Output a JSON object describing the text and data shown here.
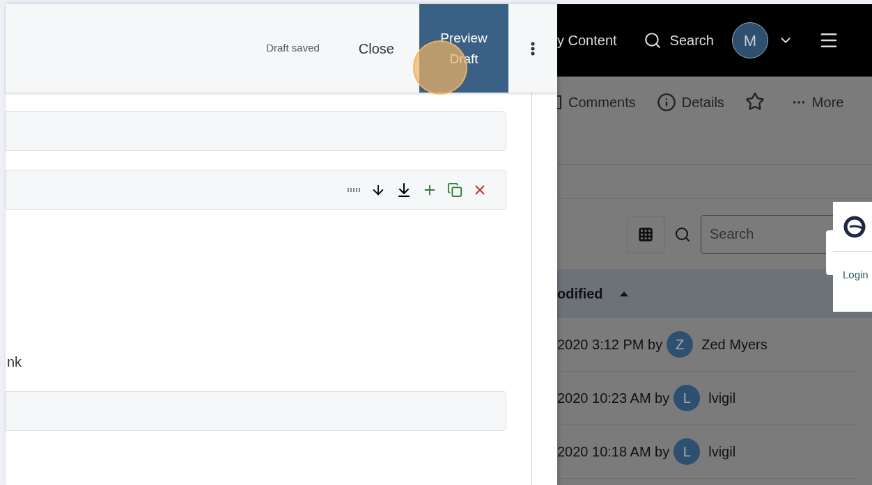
{
  "editor": {
    "status": "Draft saved",
    "close": "Close",
    "preview": "Preview Draft",
    "click_highlight": true,
    "body_text": "nk"
  },
  "background_page": {
    "nav": {
      "content_link": "y Content",
      "search": "Search",
      "avatar": "M"
    },
    "actions": [
      {
        "label": "Comments",
        "kind": "comment"
      },
      {
        "label": "Details",
        "kind": "info"
      },
      {
        "kind": "star"
      },
      {
        "label": "More",
        "kind": "more"
      }
    ],
    "search": {
      "placeholder": "Search"
    },
    "table": {
      "column": "odified",
      "sort_ascending": true,
      "rows": [
        {
          "modified": "2020 3:12 PM by",
          "avatar": "Z",
          "user": "Zed Myers"
        },
        {
          "modified": "2020 10:23 AM by",
          "avatar": "L",
          "user": "lvigil"
        },
        {
          "modified": "2020 10:18 AM by",
          "avatar": "L",
          "user": "lvigil"
        }
      ]
    }
  },
  "popup": {
    "link": "Login"
  }
}
